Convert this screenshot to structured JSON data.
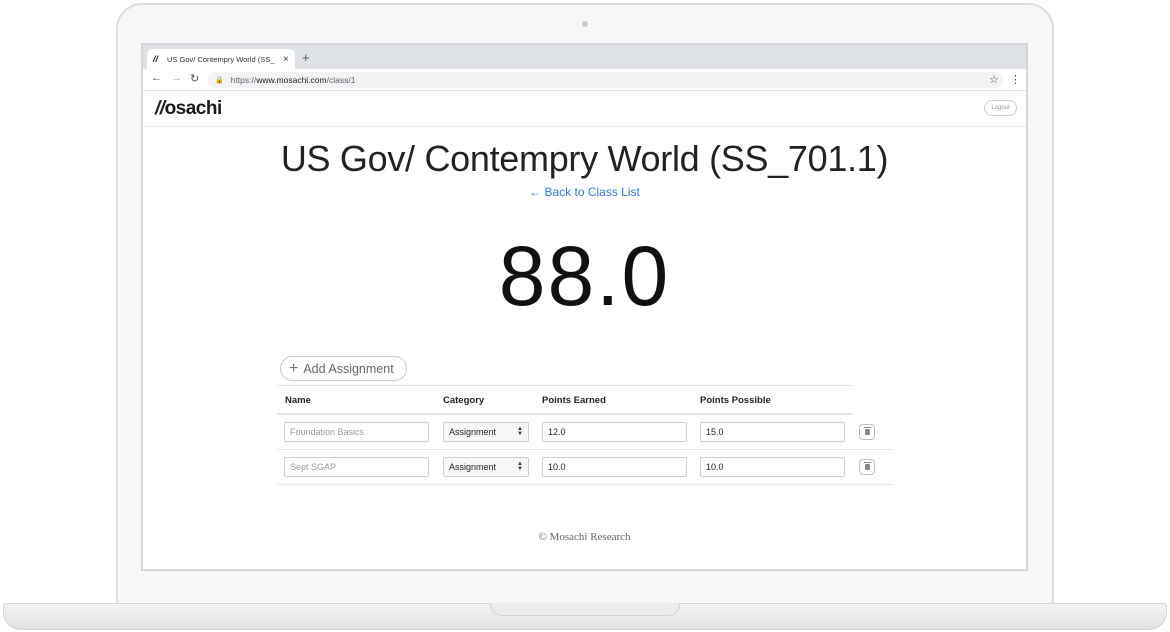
{
  "browser": {
    "tab_title": "US Gov/ Contempry World (SS_",
    "tab_favicon": "//",
    "tab_close": "×",
    "new_tab": "+",
    "nav": {
      "back": "←",
      "forward": "→",
      "reload": "↻"
    },
    "lock_icon": "🔒",
    "url_scheme": "https://",
    "url_host": "www.mosachi.com",
    "url_path": "/class/1",
    "bookmark_icon": "☆",
    "menu_icon": "⋮"
  },
  "navbar": {
    "logo_mark": "//",
    "logo_text": "osachi",
    "logout_label": "Logout"
  },
  "main": {
    "class_title": "US Gov/ Contempry World (SS_701.1)",
    "back_link": "← Back to Class List",
    "grade": "88.0",
    "add_assignment": {
      "icon": "+",
      "label": "Add Assignment"
    }
  },
  "table": {
    "headers": {
      "name": "Name",
      "category": "Category",
      "earned": "Points Earned",
      "possible": "Points Possible"
    },
    "rows": [
      {
        "name": "Foundation Basics",
        "category": "Assignment",
        "earned": "12.0",
        "possible": "15.0"
      },
      {
        "name": "Sept SGAP",
        "category": "Assignment",
        "earned": "10.0",
        "possible": "10.0"
      }
    ]
  },
  "footer": {
    "text": "© Mosachi Research"
  },
  "colors": {
    "link": "#2f7ad9",
    "text": "#222222",
    "border": "#cfcfcf"
  }
}
